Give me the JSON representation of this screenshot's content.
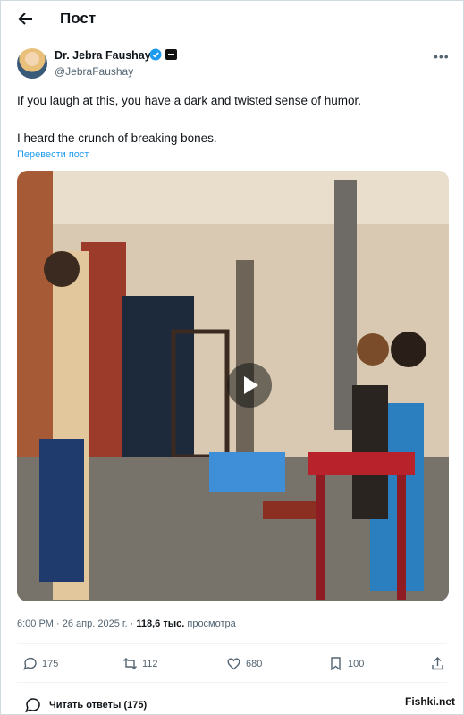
{
  "header": {
    "title": "Пост",
    "back_icon": "arrow-left-icon"
  },
  "post": {
    "author_name": "Dr. Jebra Faushay",
    "handle": "@JebraFaushay",
    "verified": true,
    "text_line_1": "If you laugh at this, you have a dark and twisted sense of humor.",
    "text_line_2": "I heard the crunch of breaking bones.",
    "translate_label": "Перевести пост",
    "timestamp": "6:00 PM · 26 апр. 2025 г. · ",
    "views_count": "118,6 тыс.",
    "views_label": " просмотра"
  },
  "actions": {
    "replies": "175",
    "reposts": "112",
    "likes": "680",
    "bookmarks": "100"
  },
  "read_replies": {
    "label": "Читать ответы (175)"
  },
  "watermark": "Fishki.net",
  "colors": {
    "accent": "#1d9bf0",
    "text": "#0f1419",
    "muted": "#536471"
  }
}
